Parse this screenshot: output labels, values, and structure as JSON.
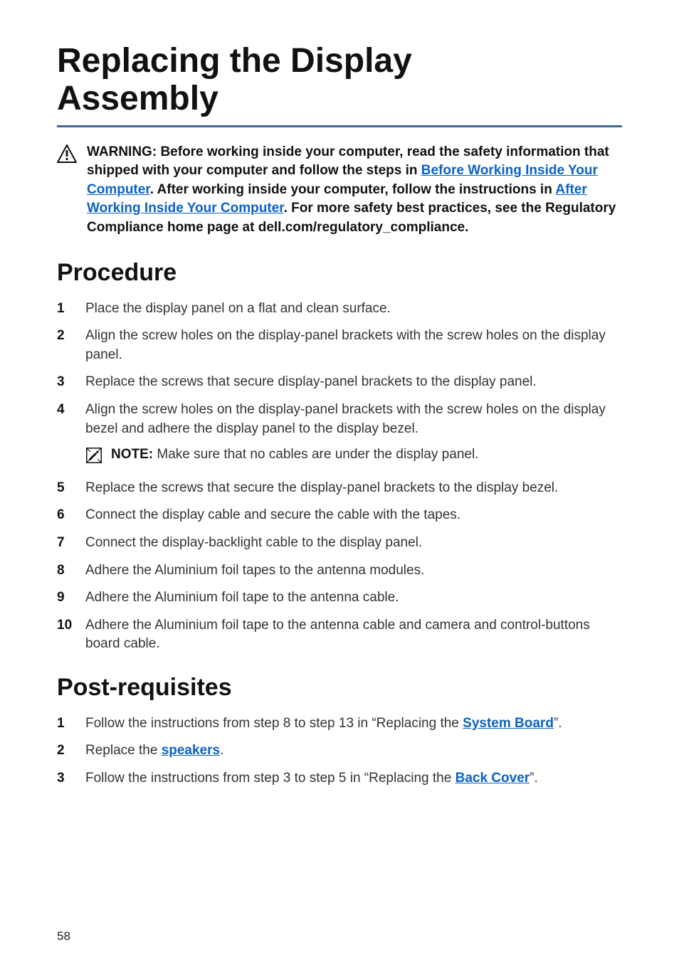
{
  "title_line1": "Replacing the Display",
  "title_line2": "Assembly",
  "warning": {
    "lead": "WARNING: ",
    "part1": "Before working inside your computer, read the safety information that shipped with your computer and follow the steps in ",
    "link1": "Before Working Inside Your Computer",
    "part2": ". After working inside your computer, follow the instructions in ",
    "link2": "After Working Inside Your Computer",
    "part3": ". For more safety best practices, see the Regulatory Compliance home page at dell.com/regulatory_compliance."
  },
  "procedure_heading": "Procedure",
  "procedure": {
    "s1": "Place the display panel on a flat and clean surface.",
    "s2": "Align the screw holes on the display-panel brackets with the screw holes on the display panel.",
    "s3": "Replace the screws that secure display-panel brackets to the display panel.",
    "s4": "Align the screw holes on the display-panel brackets with the screw holes on the display bezel and adhere the display panel to the display bezel.",
    "note_label": "NOTE: ",
    "note_text": "Make sure that no cables are under the display panel.",
    "s5": "Replace the screws that secure the display-panel brackets to the display bezel.",
    "s6": "Connect the display cable and secure the cable with the tapes.",
    "s7": "Connect the display-backlight cable to the display panel.",
    "s8": "Adhere the Aluminium foil tapes to the antenna modules.",
    "s9": "Adhere the Aluminium foil tape to the antenna cable.",
    "s10": "Adhere the Aluminium foil tape to the antenna cable and camera and control-buttons board cable."
  },
  "post_heading": "Post-requisites",
  "post": {
    "p1a": "Follow the instructions from step 8 to step 13 in “Replacing the ",
    "p1_link": "System Board",
    "p1b": "”.",
    "p2a": "Replace the ",
    "p2_link": "speakers",
    "p2b": ".",
    "p3a": "Follow the instructions from step 3 to step 5 in “Replacing the ",
    "p3_link": "Back Cover",
    "p3b": "”."
  },
  "page_number": "58"
}
